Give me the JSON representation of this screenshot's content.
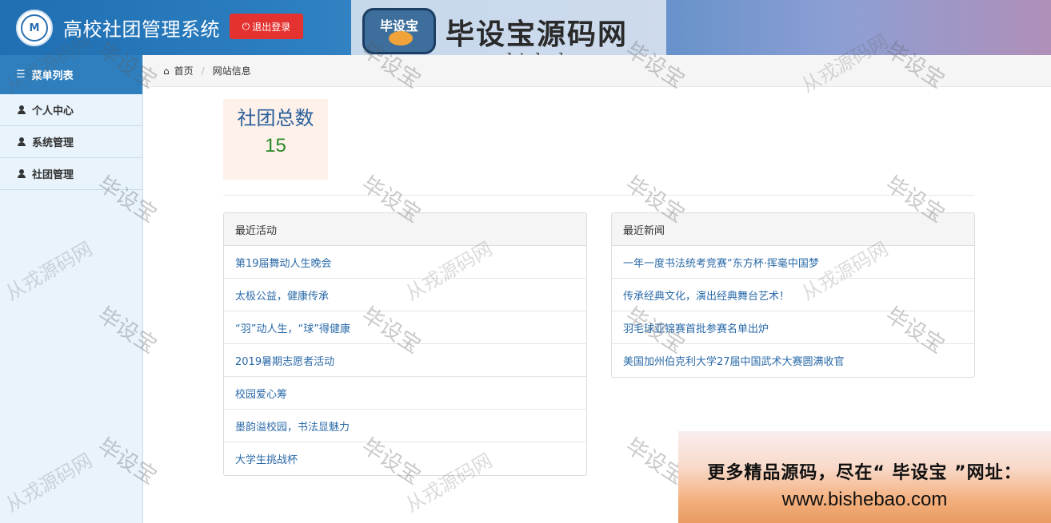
{
  "header": {
    "logo_text": "M",
    "title": "高校社团管理系统",
    "logout_label": "退出登录",
    "logout_icon": "power-icon"
  },
  "banner": {
    "badge": "毕设宝",
    "title": "毕设宝源码网",
    "url": "www.bishebao.com"
  },
  "sidebar": {
    "header": "菜单列表",
    "items": [
      {
        "label": "个人中心",
        "icon": "user-icon"
      },
      {
        "label": "系统管理",
        "icon": "user-icon"
      },
      {
        "label": "社团管理",
        "icon": "user-icon"
      }
    ]
  },
  "breadcrumb": {
    "home": "首页",
    "current": "网站信息"
  },
  "stat": {
    "label": "社团总数",
    "value": "15"
  },
  "activities": {
    "title": "最近活动",
    "items": [
      "第19届舞动人生晚会",
      "太极公益，健康传承",
      "“羽”动人生，“球”得健康",
      "2019暑期志愿者活动",
      "校园爱心筹",
      "墨韵溢校园，书法显魅力",
      "大学生挑战杯"
    ]
  },
  "news": {
    "title": "最近新闻",
    "items": [
      "一年一度书法统考竞赛“东方杯·挥毫中国梦",
      "传承经典文化，演出经典舞台艺术！",
      "羽毛球亚锦赛首批参赛名单出炉",
      "美国加州伯克利大学27届中国武术大赛圆满收官"
    ]
  },
  "watermark": {
    "text1": "毕设宝",
    "text2": "从戎源码网"
  },
  "promo": {
    "line1": "更多精品源码，尽在“ 毕设宝 ”网址：",
    "line2": "www.bishebao.com"
  },
  "colors": {
    "accent": "#2f7fbf",
    "logout": "#e3322f",
    "link": "#2a6aa8",
    "stat_value": "#2a8a2a"
  }
}
